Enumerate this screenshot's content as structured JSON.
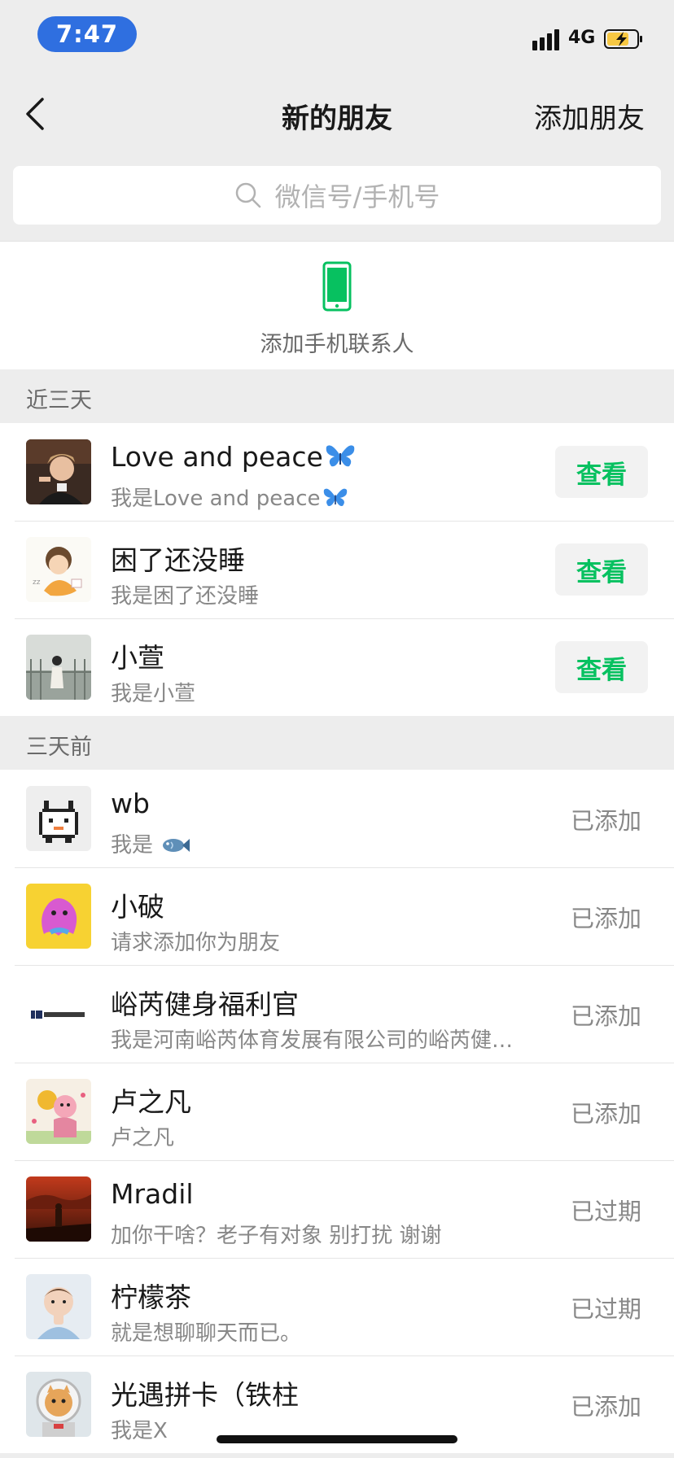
{
  "status_bar": {
    "time": "7:47",
    "network": "4G",
    "battery_color": "#f7c843"
  },
  "nav": {
    "title": "新的朋友",
    "add_friend": "添加朋友"
  },
  "search": {
    "placeholder": "微信号/手机号"
  },
  "phone_contacts": {
    "label": "添加手机联系人",
    "icon_color": "#07c160"
  },
  "sections": [
    {
      "label": "近三天",
      "items": [
        {
          "name": "Love and peace",
          "name_emoji": "butterfly-icon",
          "message": "我是Love and peace",
          "message_emoji": "butterfly-icon",
          "action": "查看",
          "avatar": "photo-avatar-man"
        },
        {
          "name": "困了还没睡",
          "message": "我是困了还没睡",
          "action": "查看",
          "avatar": "cartoon-girl-avatar"
        },
        {
          "name": "小萱",
          "message": "我是小萱",
          "action": "查看",
          "avatar": "photo-avatar-girl"
        }
      ]
    },
    {
      "label": "三天前",
      "items": [
        {
          "name": "wb",
          "message": "我是",
          "message_emoji": "fish-icon",
          "status": "已添加",
          "avatar": "pixel-cat-avatar"
        },
        {
          "name": "小破",
          "message": "请求添加你为朋友",
          "status": "已添加",
          "avatar": "pink-blob-avatar"
        },
        {
          "name": "峪芮健身福利官",
          "message": "我是河南峪芮体育发展有限公司的峪芮健…",
          "status": "已添加",
          "avatar": "brand-logo-avatar"
        },
        {
          "name": "卢之凡",
          "message": "卢之凡",
          "status": "已添加",
          "avatar": "cartoon-pig-avatar"
        },
        {
          "name": "Mradil",
          "message": "加你干啥？老子有对象 别打扰 谢谢",
          "status": "已过期",
          "avatar": "photo-avatar-sunset"
        },
        {
          "name": "柠檬茶",
          "message": "就是想聊聊天而已。",
          "status": "已过期",
          "avatar": "photo-avatar-baby"
        },
        {
          "name": "光遇拼卡（铁柱",
          "message": "我是X",
          "status": "已添加",
          "avatar": "photo-avatar-astronaut-cat"
        }
      ]
    }
  ],
  "colors": {
    "accent_green": "#07c160",
    "background": "#ededed",
    "status_pill": "#2f6fe0"
  }
}
